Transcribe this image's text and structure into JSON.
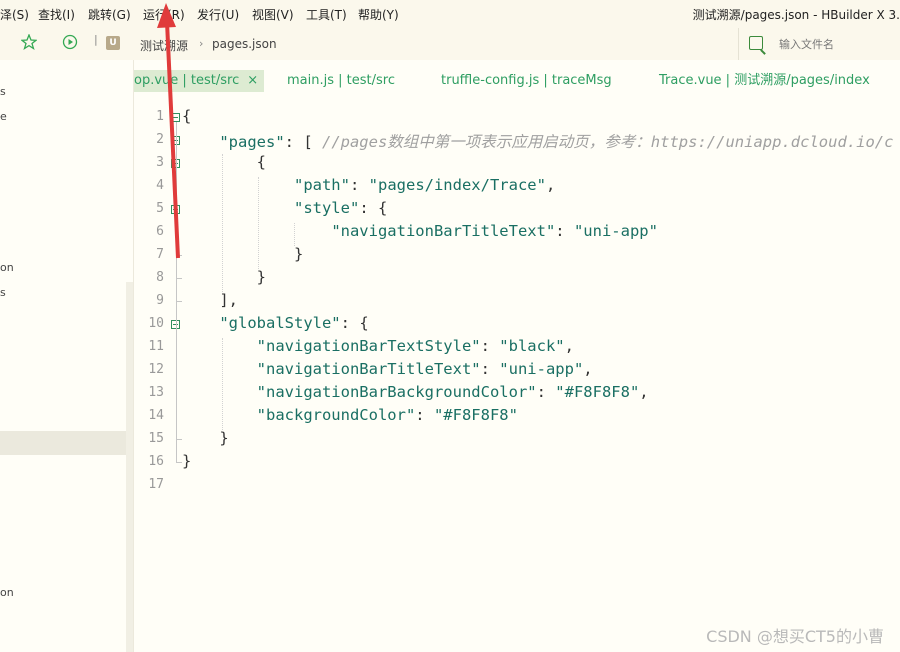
{
  "menu": [
    "泽(S)",
    "查找(I)",
    "跳转(G)",
    "运行(R)",
    "发行(U)",
    "视图(V)",
    "工具(T)",
    "帮助(Y)"
  ],
  "window_title": "测试溯源/pages.json - HBuilder X 3.",
  "toolbar": {
    "star_icon": "star-icon",
    "run_icon": "play-circle-icon",
    "project_icon_letter": "U",
    "breadcrumb": [
      "测试溯源",
      "pages.json"
    ],
    "file_search_placeholder": "输入文件名"
  },
  "sidebar_fragments": [
    "s",
    "e",
    "on",
    "s",
    "on"
  ],
  "tabs": [
    {
      "label": "op.vue | test/src",
      "active": true,
      "close": "×"
    },
    {
      "label": "main.js | test/src",
      "active": false
    },
    {
      "label": "truffle-config.js | traceMsg",
      "active": false
    },
    {
      "label": "Trace.vue | 测试溯源/pages/index",
      "active": false
    }
  ],
  "editor": {
    "line_numbers": [
      "1",
      "2",
      "3",
      "4",
      "5",
      "6",
      "7",
      "8",
      "9",
      "10",
      "11",
      "12",
      "13",
      "14",
      "15",
      "16",
      "17"
    ],
    "lines": [
      [
        [
          "p",
          "{"
        ]
      ],
      [
        [
          "p",
          "    "
        ],
        [
          "k",
          "\"pages\""
        ],
        [
          "p",
          ": [ "
        ],
        [
          "c",
          "//pages数组中第一项表示应用启动页，参考：https://uniapp.dcloud.io/c"
        ]
      ],
      [
        [
          "p",
          "        {"
        ]
      ],
      [
        [
          "p",
          "            "
        ],
        [
          "k",
          "\"path\""
        ],
        [
          "p",
          ": "
        ],
        [
          "s",
          "\"pages/index/Trace\""
        ],
        [
          "p",
          ","
        ]
      ],
      [
        [
          "p",
          "            "
        ],
        [
          "k",
          "\"style\""
        ],
        [
          "p",
          ": {"
        ]
      ],
      [
        [
          "p",
          "                "
        ],
        [
          "k",
          "\"navigationBarTitleText\""
        ],
        [
          "p",
          ": "
        ],
        [
          "s",
          "\"uni-app\""
        ]
      ],
      [
        [
          "p",
          "            }"
        ]
      ],
      [
        [
          "p",
          "        }"
        ]
      ],
      [
        [
          "p",
          "    ],"
        ]
      ],
      [
        [
          "p",
          "    "
        ],
        [
          "k",
          "\"globalStyle\""
        ],
        [
          "p",
          ": {"
        ]
      ],
      [
        [
          "p",
          "        "
        ],
        [
          "k",
          "\"navigationBarTextStyle\""
        ],
        [
          "p",
          ": "
        ],
        [
          "s",
          "\"black\""
        ],
        [
          "p",
          ","
        ]
      ],
      [
        [
          "p",
          "        "
        ],
        [
          "k",
          "\"navigationBarTitleText\""
        ],
        [
          "p",
          ": "
        ],
        [
          "s",
          "\"uni-app\""
        ],
        [
          "p",
          ","
        ]
      ],
      [
        [
          "p",
          "        "
        ],
        [
          "k",
          "\"navigationBarBackgroundColor\""
        ],
        [
          "p",
          ": "
        ],
        [
          "s",
          "\"#F8F8F8\""
        ],
        [
          "p",
          ","
        ]
      ],
      [
        [
          "p",
          "        "
        ],
        [
          "k",
          "\"backgroundColor\""
        ],
        [
          "p",
          ": "
        ],
        [
          "s",
          "\"#F8F8F8\""
        ]
      ],
      [
        [
          "p",
          "    }"
        ]
      ],
      [
        [
          "p",
          "}"
        ]
      ],
      [
        [
          "p",
          ""
        ]
      ]
    ]
  },
  "watermark": "CSDN @想买CT5的小曹",
  "colors": {
    "accent": "#2e9e62",
    "annotation": "#e03b3b",
    "string": "#1a6f63",
    "comment": "#a0a0a0"
  }
}
